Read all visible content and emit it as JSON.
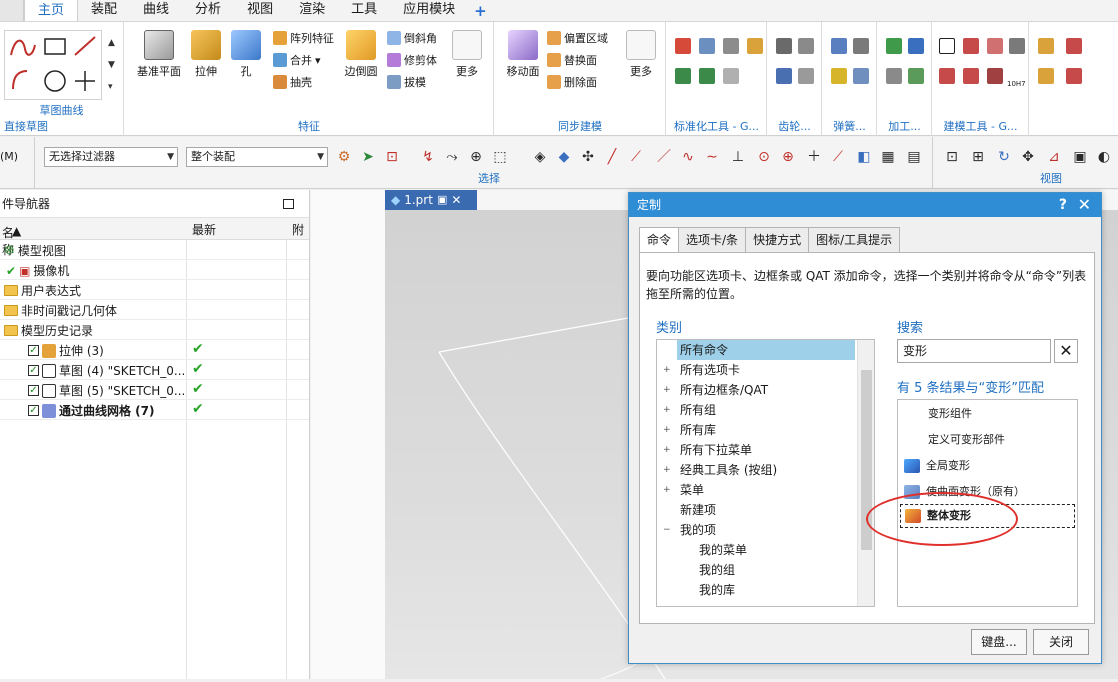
{
  "menu": {
    "tabs": [
      "主页",
      "装配",
      "曲线",
      "分析",
      "视图",
      "渲染",
      "工具",
      "应用模块"
    ],
    "active": "主页",
    "plus": "+"
  },
  "ribbon": {
    "sketch_group_label": "草图曲线",
    "direct_sketch_label": "直接草图",
    "feature_group_label": "特征",
    "feature_big": [
      "基准平面",
      "拉伸",
      "孔",
      "边倒圆",
      "更多"
    ],
    "feature_small": [
      "阵列特征",
      "合并",
      "抽壳",
      "倒斜角",
      "修剪体",
      "拔模"
    ],
    "sync_group_label": "同步建模",
    "sync_big": [
      "移动面",
      "更多"
    ],
    "sync_small": [
      "偏置区域",
      "替换面",
      "删除面"
    ],
    "std_group_label": "标准化工具 - G...",
    "gear_group_label": "齿轮...",
    "spring_group_label": "弹簧...",
    "mach_group_label": "加工...",
    "build_group_label": "建模工具 - G...",
    "trailing_label": "",
    "edge_text": "10H7"
  },
  "toolbar2": {
    "left_label": "(M)",
    "filter_value": "无选择过滤器",
    "assembly_value": "整个装配",
    "select_label": "选择",
    "view_label": "视图"
  },
  "navigator": {
    "title": "件导航器",
    "col_name": "名称",
    "col_latest": "最新",
    "col_extra": "附",
    "rows": [
      {
        "label": "模型视图",
        "indent": 0,
        "icon": "model-view-icon",
        "latest": ""
      },
      {
        "label": "摄像机",
        "indent": 1,
        "icon": "camera-icon",
        "latest": ""
      },
      {
        "label": "用户表达式",
        "indent": 0,
        "icon": "folder-icon",
        "latest": ""
      },
      {
        "label": "非时间戳记几何体",
        "indent": 0,
        "icon": "folder-icon",
        "latest": ""
      },
      {
        "label": "模型历史记录",
        "indent": 0,
        "icon": "folder-icon",
        "latest": ""
      },
      {
        "label": "拉伸 (3)",
        "indent": 2,
        "icon": "extrude-icon",
        "latest": "✔"
      },
      {
        "label": "草图 (4) \"SKETCH_0...",
        "indent": 2,
        "icon": "sketch-icon",
        "latest": "✔"
      },
      {
        "label": "草图 (5) \"SKETCH_0...",
        "indent": 2,
        "icon": "sketch-icon",
        "latest": "✔"
      },
      {
        "label": "通过曲线网格 (7)",
        "indent": 2,
        "icon": "mesh-surface-icon",
        "latest": "✔"
      }
    ]
  },
  "viewport": {
    "doc_tab": "1.prt"
  },
  "dialog": {
    "title": "定制",
    "help": "?",
    "close": "✕",
    "tabs": [
      "命令",
      "选项卡/条",
      "快捷方式",
      "图标/工具提示"
    ],
    "active_tab": "命令",
    "instruction": "要向功能区选项卡、边框条或 QAT 添加命令，选择一个类别并将命令从“命令”列表拖至所需的位置。",
    "category_label": "类别",
    "categories": [
      {
        "label": "所有命令",
        "indent": 0,
        "selected": true,
        "expander": ""
      },
      {
        "label": "所有选项卡",
        "indent": 0,
        "selected": false,
        "expander": "+"
      },
      {
        "label": "所有边框条/QAT",
        "indent": 0,
        "selected": false,
        "expander": "+"
      },
      {
        "label": "所有组",
        "indent": 0,
        "selected": false,
        "expander": "+"
      },
      {
        "label": "所有库",
        "indent": 0,
        "selected": false,
        "expander": "+"
      },
      {
        "label": "所有下拉菜单",
        "indent": 0,
        "selected": false,
        "expander": "+"
      },
      {
        "label": "经典工具条 (按组)",
        "indent": 0,
        "selected": false,
        "expander": "+"
      },
      {
        "label": "菜单",
        "indent": 0,
        "selected": false,
        "expander": "+"
      },
      {
        "label": "新建项",
        "indent": 0,
        "selected": false,
        "expander": ""
      },
      {
        "label": "我的项",
        "indent": 0,
        "selected": false,
        "expander": "−"
      },
      {
        "label": "我的菜单",
        "indent": 1,
        "selected": false,
        "expander": ""
      },
      {
        "label": "我的组",
        "indent": 1,
        "selected": false,
        "expander": ""
      },
      {
        "label": "我的库",
        "indent": 1,
        "selected": false,
        "expander": ""
      }
    ],
    "search_label": "搜索",
    "search_value": "变形",
    "clear_label": "✕",
    "result_label": "有 5 条结果与“变形”匹配",
    "results": [
      {
        "label": "变形组件",
        "icon": "",
        "highlighted": false
      },
      {
        "label": "定义可变形部件",
        "icon": "",
        "highlighted": false
      },
      {
        "label": "全局变形",
        "icon": "global-deform-icon",
        "highlighted": false
      },
      {
        "label": "使曲面变形（原有）",
        "icon": "deform-surface-icon",
        "highlighted": false
      },
      {
        "label": "整体变形",
        "icon": "overall-deform-icon",
        "highlighted": true
      }
    ],
    "buttons": [
      "键盘...",
      "关闭"
    ]
  },
  "colors": {
    "accent": "#1f6fc2",
    "title_bar": "#2f8dd6",
    "selection": "#9fd0ea",
    "check_green": "#27a327",
    "annotation_red": "#e0302b"
  }
}
